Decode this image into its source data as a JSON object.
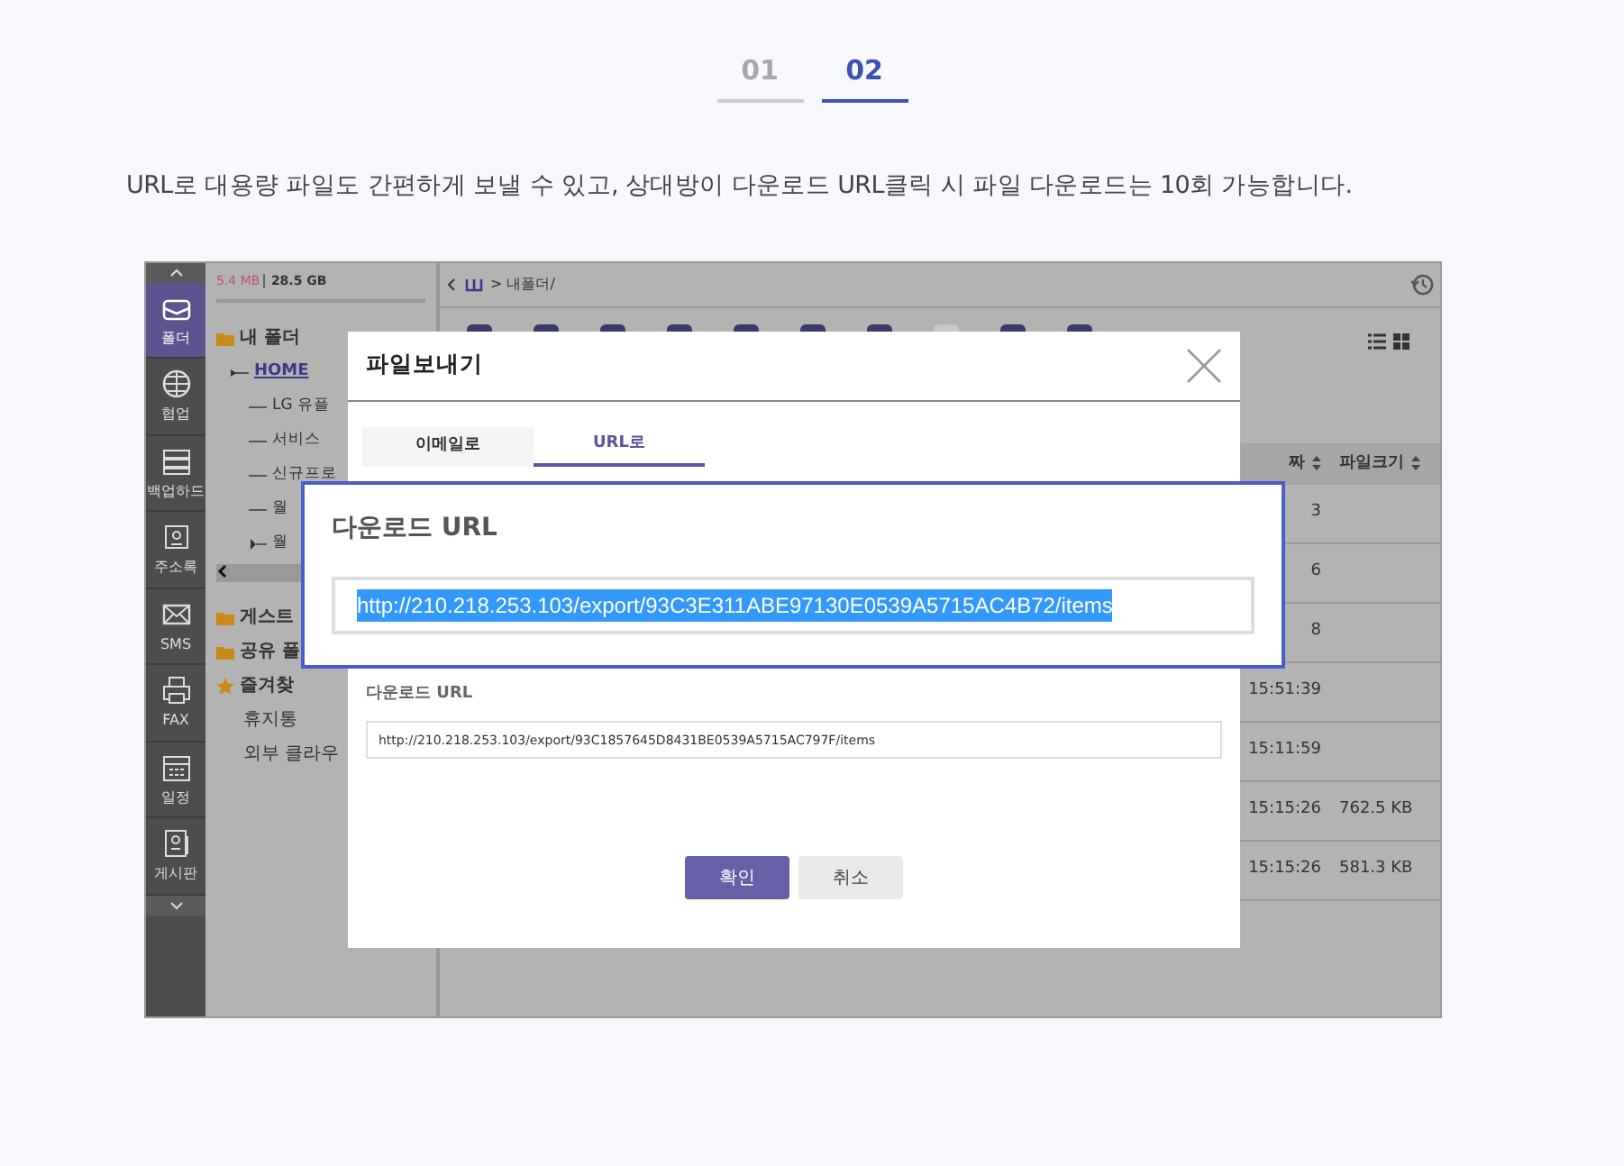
{
  "steps": [
    {
      "label": "01",
      "selected": false
    },
    {
      "label": "02",
      "selected": true
    }
  ],
  "caption": "URL로 대용량 파일도 간편하게 보낼 수 있고, 상대방이 다운로드 URL클릭 시 파일 다운로드는 10회 가능합니다.",
  "screenshot": {
    "nav": [
      {
        "label": "폴더",
        "selected": true
      },
      {
        "label": "협업",
        "selected": false
      },
      {
        "label": "백업하드",
        "selected": false
      },
      {
        "label": "주소록",
        "selected": false
      },
      {
        "label": "SMS",
        "selected": false
      },
      {
        "label": "FAX",
        "selected": false
      },
      {
        "label": "일정",
        "selected": false
      },
      {
        "label": "게시판",
        "selected": false
      }
    ],
    "storage": {
      "used": "5.4 MB",
      "total": "28.5 GB"
    },
    "tree": [
      {
        "label": "내 폴더",
        "kind": "folder",
        "children": [
          {
            "label": "HOME",
            "kind": "home",
            "children": [
              {
                "label": "LG 유플"
              },
              {
                "label": "서비스"
              },
              {
                "label": "신규프로"
              },
              {
                "label": "월"
              },
              {
                "label": "월",
                "expandable": true
              }
            ]
          }
        ]
      }
    ],
    "places": [
      {
        "label": "게스트",
        "kind": "folder"
      },
      {
        "label": "공유 폴",
        "kind": "folder"
      },
      {
        "label": "즐겨찾",
        "kind": "star"
      },
      {
        "label": "휴지통",
        "kind": "plain"
      },
      {
        "label": "외부 클라우",
        "kind": "plain"
      }
    ],
    "breadcrumb": "> 내폴더/",
    "columns": [
      "짜",
      "파일크기"
    ],
    "rows": [
      {
        "date": "3"
      },
      {
        "date": "6"
      },
      {
        "date": "8"
      },
      {
        "date": "15:51:39"
      },
      {
        "date": "15:11:59"
      },
      {
        "date": "15:15:26",
        "size": "762.5 KB"
      },
      {
        "date": "15:15:26",
        "size": "581.3 KB"
      }
    ],
    "dialog": {
      "title": "파일보내기",
      "tabs": [
        {
          "label": "이메일로",
          "selected": false
        },
        {
          "label": "URL로",
          "selected": true
        }
      ],
      "url_label": "다운로드 URL",
      "url": "http://210.218.253.103/export/93C1857645D8431BE0539A5715AC797F/items",
      "buttons": [
        {
          "label": "확인",
          "kind": "primary"
        },
        {
          "label": "취소",
          "kind": "secondary"
        }
      ]
    },
    "callout": {
      "title": "다운로드 URL",
      "url": "http://210.218.253.103/export/93C3E311ABE97130E0539A5715AC4B72/items"
    }
  }
}
